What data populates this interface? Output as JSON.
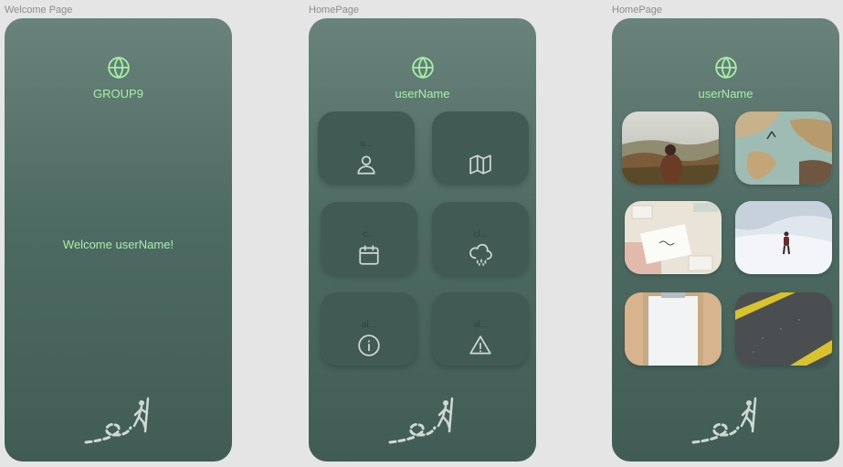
{
  "frames": [
    {
      "label": "Welcome Page",
      "title": "GROUP9",
      "welcome": "Welcome userName!"
    },
    {
      "label": "HomePage",
      "title": "userName",
      "tiles": [
        {
          "label": "u...",
          "icon": "user-icon"
        },
        {
          "label": "",
          "icon": "map-icon"
        },
        {
          "label": "c...",
          "icon": "calendar-icon"
        },
        {
          "label": "cl...",
          "icon": "cloud-rain-icon"
        },
        {
          "label": "al...",
          "icon": "info-icon"
        },
        {
          "label": "al...",
          "icon": "alert-triangle-icon"
        }
      ]
    },
    {
      "label": "HomePage",
      "title": "userName",
      "photos": [
        "hiker-mountain-photo",
        "world-map-photo",
        "desk-paper-photo",
        "snow-hiker-photo",
        "clipboard-photo",
        "road-stripes-photo"
      ]
    }
  ],
  "colors": {
    "accent": "#a6f0a6",
    "tile": "#415a53",
    "background": "#e5e5e5"
  },
  "logo_icon": "hiker-trail-icon"
}
